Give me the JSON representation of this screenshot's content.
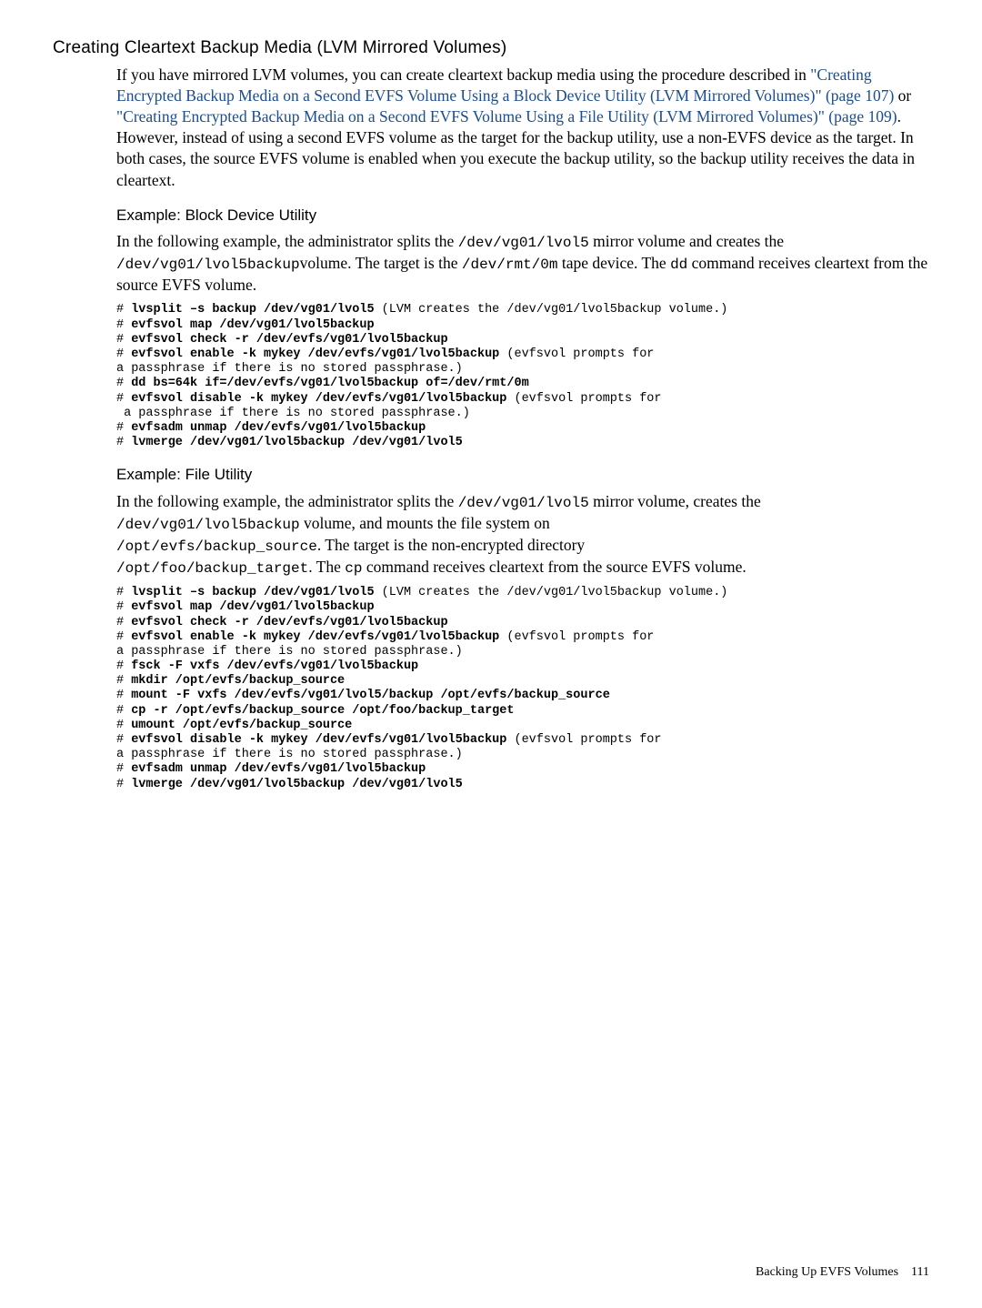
{
  "title": "Creating Cleartext Backup Media (LVM Mirrored Volumes)",
  "intro": {
    "seg1": "If you have mirrored LVM volumes, you can create cleartext backup media using the procedure described in ",
    "link1": "\"Creating Encrypted Backup Media on a Second EVFS Volume Using a Block Device Utility (LVM Mirrored Volumes)\" (page 107)",
    "seg2": " or ",
    "link2": "\"Creating Encrypted Backup Media on a Second EVFS Volume Using a File Utility (LVM Mirrored Volumes)\" (page 109)",
    "seg3": ". However, instead of using a second EVFS volume as the target for the backup utility, use a non-EVFS device as the target. In both cases, the source EVFS volume is enabled when you execute the backup utility, so the backup utility receives the data in cleartext."
  },
  "ex1": {
    "heading": "Example: Block Device Utility",
    "p_seg1": "In the following example, the administrator splits the ",
    "p_mono1": "/dev/vg01/lvol5",
    "p_seg2": " mirror volume and creates the ",
    "p_mono2": "/dev/vg01/lvol5backup",
    "p_seg3": "volume. The target is the ",
    "p_mono3": "/dev/rmt/0m",
    "p_seg4": " tape device. The ",
    "p_mono4": "dd",
    "p_seg5": " command receives cleartext from the source EVFS volume.",
    "code": {
      "l1a": "# ",
      "l1b": "lvsplit –s backup /dev/vg01/lvol5",
      "l1c": " (LVM creates the /dev/vg01/lvol5backup volume.)",
      "l2a": "# ",
      "l2b": "evfsvol map /dev/vg01/lvol5backup",
      "l3a": "# ",
      "l3b": "evfsvol check -r /dev/evfs/vg01/lvol5backup",
      "l4a": "# ",
      "l4b": "evfsvol enable -k mykey /dev/evfs/vg01/lvol5backup",
      "l4c": " (evfsvol prompts for",
      "l5": "a passphrase if there is no stored passphrase.)",
      "l6a": "# ",
      "l6b": "dd bs=64k if=/dev/evfs/vg01/lvol5backup of=/dev/rmt/0m",
      "l7a": "# ",
      "l7b": "evfsvol disable -k mykey /dev/evfs/vg01/lvol5backup",
      "l7c": " (evfsvol prompts for",
      "l8": " a passphrase if there is no stored passphrase.)",
      "l9a": "# ",
      "l9b": "evfsadm unmap /dev/evfs/vg01/lvol5backup",
      "l10a": "# ",
      "l10b": "lvmerge /dev/vg01/lvol5backup /dev/vg01/lvol5"
    }
  },
  "ex2": {
    "heading": "Example: File Utility",
    "p_seg1": "In the following example, the administrator splits the ",
    "p_mono1": "/dev/vg01/lvol5",
    "p_seg2": " mirror volume, creates the ",
    "p_mono2": "/dev/vg01/lvol5backup",
    "p_seg3": " volume, and mounts the file system on ",
    "p_mono3": "/opt/evfs/backup_source",
    "p_seg4": ". The target is the non-encrypted directory ",
    "p_mono4": "/opt/foo/backup_target",
    "p_seg5": ". The ",
    "p_mono5": "cp",
    "p_seg6": " command receives cleartext from the source EVFS volume.",
    "code": {
      "l1a": "# ",
      "l1b": "lvsplit –s backup /dev/vg01/lvol5",
      "l1c": " (LVM creates the /dev/vg01/lvol5backup volume.)",
      "l2a": "# ",
      "l2b": "evfsvol map /dev/vg01/lvol5backup",
      "l3a": "# ",
      "l3b": "evfsvol check -r /dev/evfs/vg01/lvol5backup",
      "l4a": "# ",
      "l4b": "evfsvol enable -k mykey /dev/evfs/vg01/lvol5backup",
      "l4c": " (evfsvol prompts for",
      "l5": "a passphrase if there is no stored passphrase.)",
      "l6a": "# ",
      "l6b": "fsck -F vxfs /dev/evfs/vg01/lvol5backup",
      "l7a": "# ",
      "l7b": "mkdir /opt/evfs/backup_source",
      "l8a": "# ",
      "l8b": "mount -F vxfs /dev/evfs/vg01/lvol5/backup /opt/evfs/backup_source",
      "l9a": "# ",
      "l9b": "cp -r /opt/evfs/backup_source /opt/foo/backup_target",
      "l10a": "# ",
      "l10b": "umount /opt/evfs/backup_source",
      "l11a": "# ",
      "l11b": "evfsvol disable -k mykey /dev/evfs/vg01/lvol5backup",
      "l11c": " (evfsvol prompts for",
      "l12": "a passphrase if there is no stored passphrase.)",
      "l13a": "# ",
      "l13b": "evfsadm unmap /dev/evfs/vg01/lvol5backup",
      "l14a": "# ",
      "l14b": "lvmerge /dev/vg01/lvol5backup /dev/vg01/lvol5"
    }
  },
  "footer": {
    "text": "Backing Up EVFS Volumes",
    "page": "111"
  }
}
